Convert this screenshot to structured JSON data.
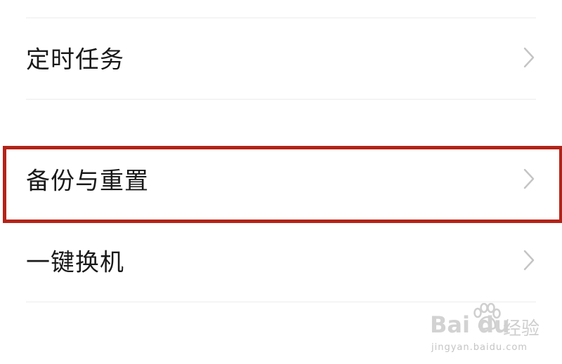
{
  "settings_list": {
    "items": [
      {
        "label": "定时任务",
        "icon": "chevron-right-icon"
      },
      {
        "label": "备份与重置",
        "icon": "chevron-right-icon",
        "highlighted": true
      },
      {
        "label": "一键换机",
        "icon": "chevron-right-icon"
      }
    ]
  },
  "annotation": {
    "highlight_color": "#b42318"
  },
  "watermark": {
    "brand": "Bai du",
    "brand_cn": "经验",
    "url": "jingyan.baidu.com"
  }
}
